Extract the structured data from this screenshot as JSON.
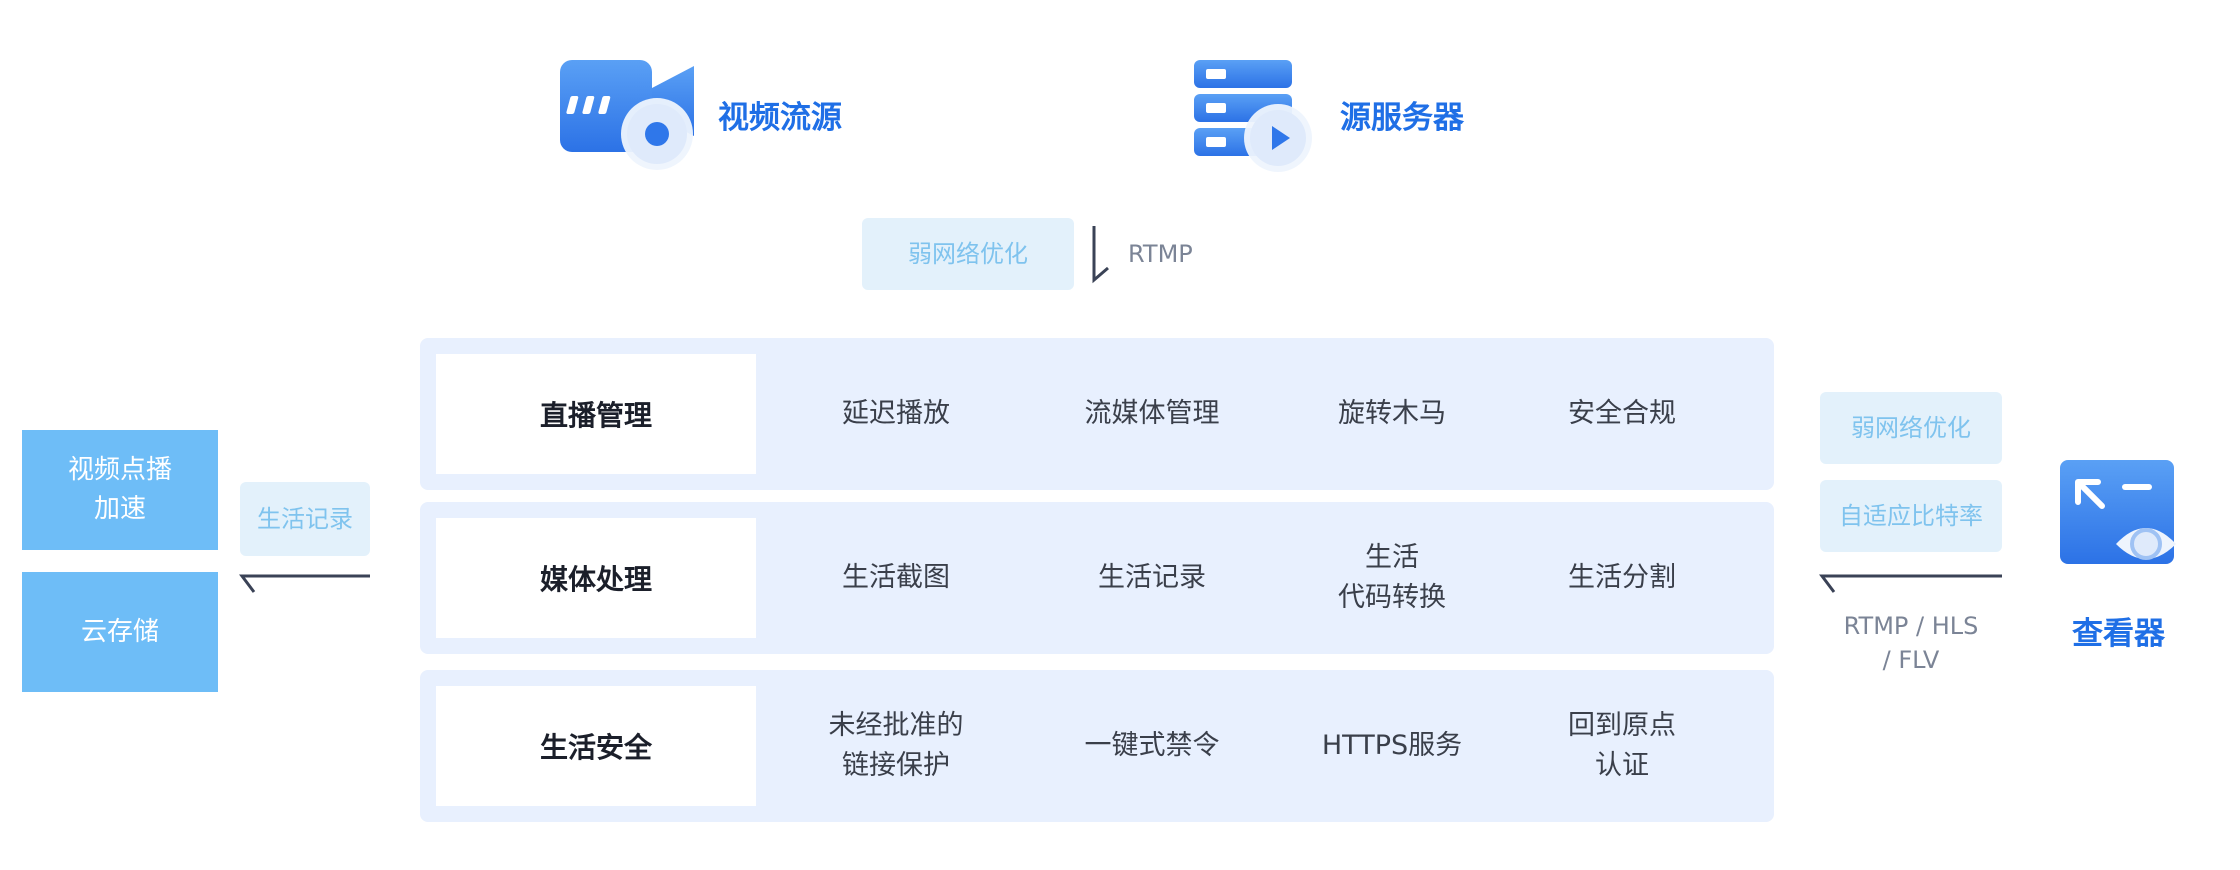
{
  "top": {
    "video_source_label": "视频流源",
    "origin_server_label": "源服务器"
  },
  "ingest": {
    "chip": "弱网络优化",
    "protocol": "RTMP"
  },
  "left": {
    "vod_label": "视频点播\n加速",
    "storage_label": "云存储",
    "record_chip": "生活记录"
  },
  "right": {
    "chip_weak": "弱网络优化",
    "chip_abr": "自适应比特率",
    "protocol": "RTMP / HLS\n/ FLV",
    "viewer_label": "查看器"
  },
  "rows": [
    {
      "head": "直播管理",
      "cells": [
        "延迟播放",
        "流媒体管理",
        "旋转木马",
        "安全合规"
      ]
    },
    {
      "head": "媒体处理",
      "cells": [
        "生活截图",
        "生活记录",
        "生活\n代码转换",
        "生活分割"
      ]
    },
    {
      "head": "生活安全",
      "cells": [
        "未经批准的\n链接保护",
        "一键式禁令",
        "HTTPS服务",
        "回到原点\n认证"
      ]
    }
  ],
  "colors": {
    "accent": "#1f6fe6",
    "icon_blue": "#3f86f0",
    "chip_bg": "#e3f1fb",
    "chip_text": "#7fc3ee",
    "panel_bg": "#e8f0fe",
    "side_block": "#6ebdf7",
    "arrow": "#3a4256"
  },
  "icons": [
    "video-camera-icon",
    "server-play-icon",
    "viewer-eye-icon"
  ]
}
